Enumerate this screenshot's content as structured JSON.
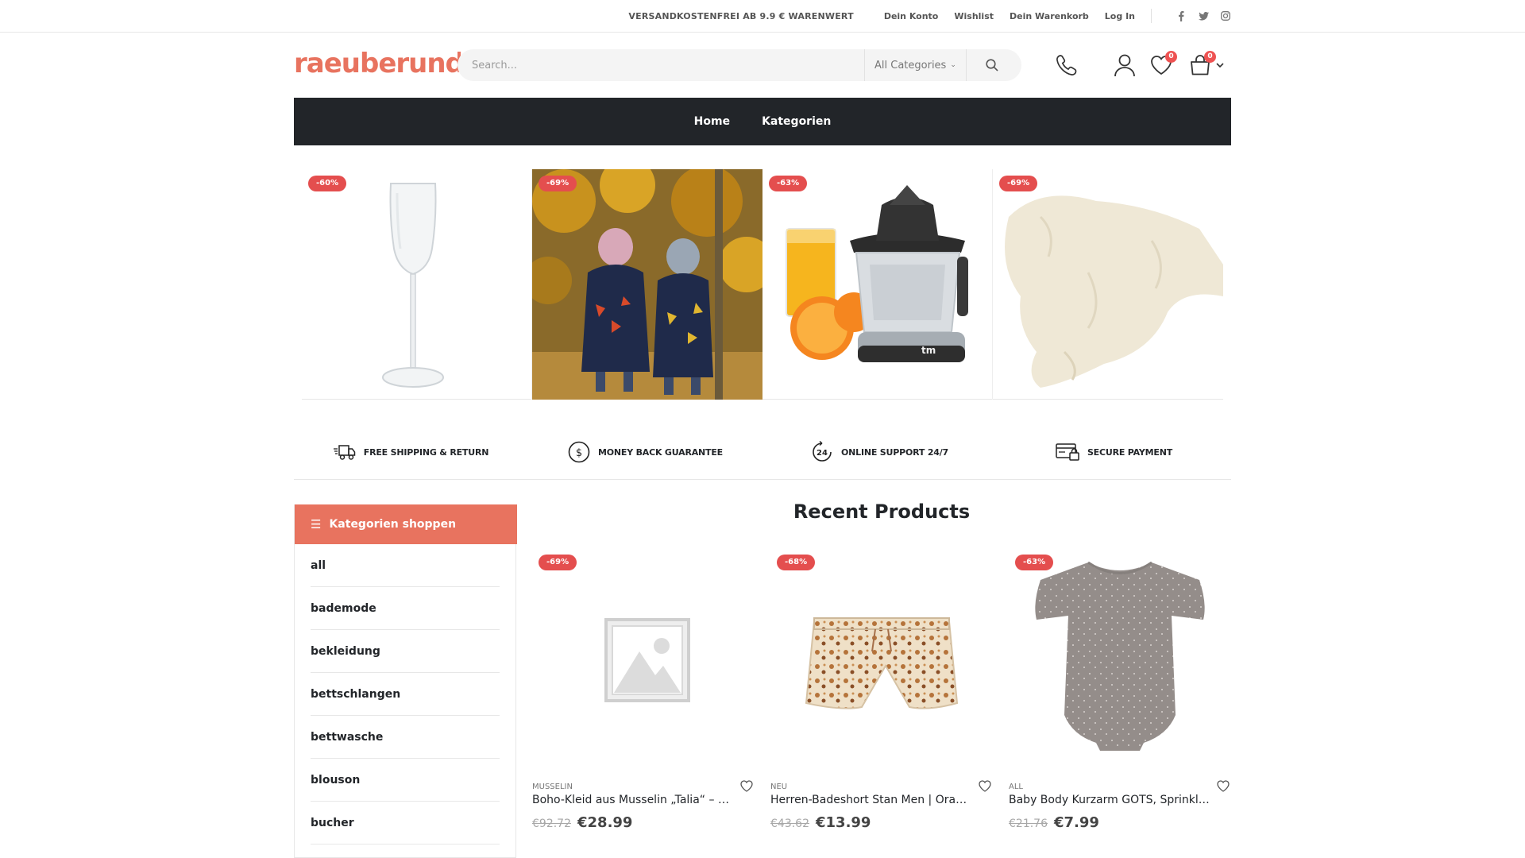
{
  "topbar": {
    "promo": "VERSANDKOSTENFREI AB 9.9 € WARENWERT",
    "links": [
      "Dein Konto",
      "Wishlist",
      "Dein Warenkorb",
      "Log In"
    ],
    "social": [
      "facebook-icon",
      "twitter-icon",
      "instagram-icon"
    ]
  },
  "header": {
    "logo": "raeuberund",
    "search_placeholder": "Search...",
    "category_select": "All Categories",
    "wishlist_count": "0",
    "cart_count": "0"
  },
  "nav": {
    "items": [
      "Home",
      "Kategorien"
    ]
  },
  "hero": {
    "slides": [
      {
        "discount": "-60%",
        "subject": "champagne glass"
      },
      {
        "discount": "-69%",
        "subject": "kids in dino coats"
      },
      {
        "discount": "-63%",
        "subject": "citrus juicer"
      },
      {
        "discount": "-69%",
        "subject": "plush toy"
      }
    ]
  },
  "features": [
    {
      "icon": "truck-icon",
      "label": "FREE SHIPPING & RETURN"
    },
    {
      "icon": "dollar-icon",
      "label": "MONEY BACK GUARANTEE"
    },
    {
      "icon": "support-24-icon",
      "label": "ONLINE SUPPORT 24/7"
    },
    {
      "icon": "secure-card-icon",
      "label": "SECURE PAYMENT"
    }
  ],
  "sidebar": {
    "title": "Kategorien shoppen",
    "items": [
      "all",
      "bademode",
      "bekleidung",
      "bettschlangen",
      "bettwasche",
      "blouson",
      "bucher"
    ]
  },
  "recent": {
    "title": "Recent Products",
    "products": [
      {
        "discount": "-69%",
        "category": "MUSSELIN",
        "name": "Boho-Kleid aus Musselin „Talia“ – M...",
        "old_price": "€92.72",
        "price": "€28.99"
      },
      {
        "discount": "-68%",
        "category": "NEU",
        "name": "Herren-Badeshort Stan Men | Oran...",
        "old_price": "€43.62",
        "price": "€13.99"
      },
      {
        "discount": "-63%",
        "category": "ALL",
        "name": "Baby Body Kurzarm GOTS, Sprinkle ...",
        "old_price": "€21.76",
        "price": "€7.99"
      }
    ]
  },
  "colors": {
    "accent": "#e8735f",
    "nav_bg": "#222529",
    "badge": "#e44e4e"
  }
}
